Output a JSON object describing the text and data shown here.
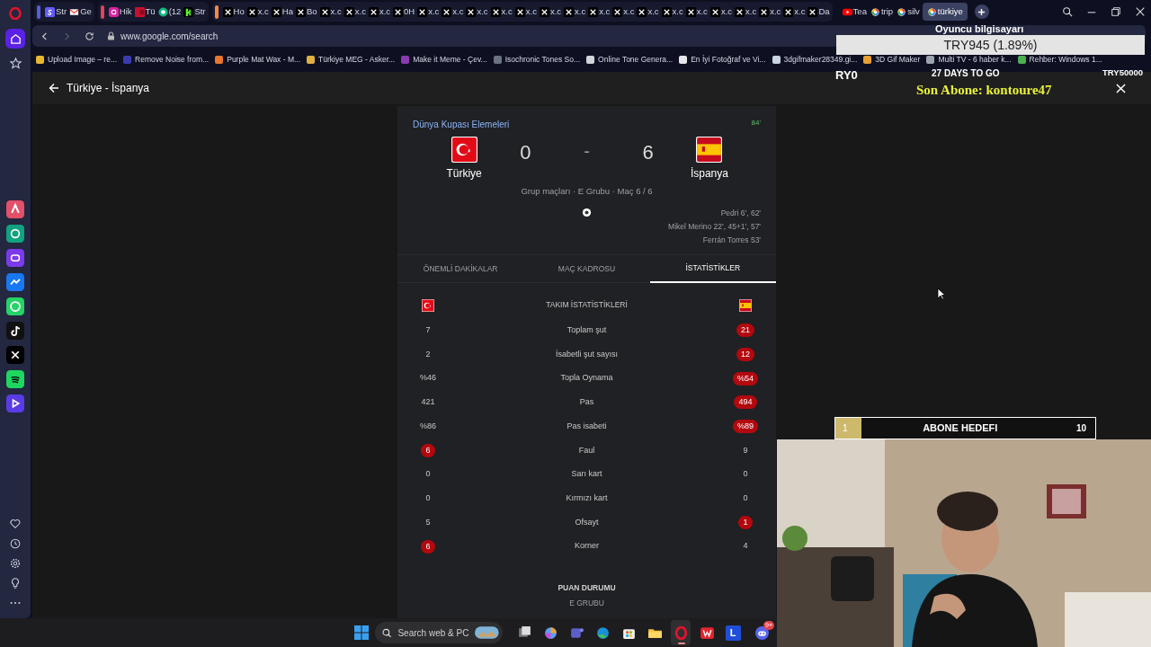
{
  "browser": {
    "tab_groups": [
      {
        "color": "#5b5bd6",
        "tabs": [
          {
            "label": "Str",
            "kind": "stripe",
            "selected": false
          },
          {
            "label": "Ge",
            "kind": "gmail",
            "selected": false
          }
        ]
      },
      {
        "color": "#e0435a",
        "tabs": [
          {
            "label": "Hik",
            "kind": "instagram",
            "selected": false
          },
          {
            "label": "Tü",
            "kind": "flag",
            "selected": false
          },
          {
            "label": "(12",
            "kind": "chat",
            "selected": false
          },
          {
            "label": "Str",
            "kind": "kick",
            "selected": false
          }
        ]
      },
      {
        "color": "#f08a4b",
        "tabs": [
          {
            "label": "Ho",
            "kind": "x",
            "selected": false
          },
          {
            "label": "x.c",
            "kind": "x",
            "selected": false
          },
          {
            "label": "Ha",
            "kind": "x",
            "selected": false
          },
          {
            "label": "Bo",
            "kind": "x",
            "selected": false
          },
          {
            "label": "x.c",
            "kind": "x",
            "selected": false
          },
          {
            "label": "x.c",
            "kind": "x",
            "selected": false
          },
          {
            "label": "x.c",
            "kind": "x",
            "selected": false
          },
          {
            "label": "0H",
            "kind": "x",
            "selected": false
          },
          {
            "label": "x.c",
            "kind": "x",
            "selected": false
          },
          {
            "label": "x.c",
            "kind": "x",
            "selected": false
          },
          {
            "label": "x.c",
            "kind": "x",
            "selected": false
          },
          {
            "label": "x.c",
            "kind": "x",
            "selected": false
          },
          {
            "label": "x.c",
            "kind": "x",
            "selected": false
          },
          {
            "label": "x.c",
            "kind": "x",
            "selected": false
          },
          {
            "label": "x.c",
            "kind": "x",
            "selected": false
          },
          {
            "label": "x.c",
            "kind": "x",
            "selected": false
          },
          {
            "label": "x.c",
            "kind": "x",
            "selected": false
          },
          {
            "label": "x.c",
            "kind": "x",
            "selected": false
          },
          {
            "label": "x.c",
            "kind": "x",
            "selected": false
          },
          {
            "label": "x.c",
            "kind": "x",
            "selected": false
          },
          {
            "label": "x.c",
            "kind": "x",
            "selected": false
          },
          {
            "label": "x.c",
            "kind": "x",
            "selected": false
          },
          {
            "label": "x.c",
            "kind": "x",
            "selected": false
          },
          {
            "label": "x.c",
            "kind": "x",
            "selected": false
          },
          {
            "label": "Da",
            "kind": "x",
            "selected": false
          }
        ]
      }
    ],
    "tabs": [
      {
        "label": "Tea",
        "kind": "youtube",
        "selected": false
      },
      {
        "label": "trip",
        "kind": "google",
        "selected": false
      },
      {
        "label": "silv",
        "kind": "google",
        "selected": false
      },
      {
        "label": "türkiye",
        "kind": "google",
        "selected": true
      }
    ],
    "address": "www.google.com/search",
    "bookmarks": [
      {
        "label": "Upload Image – re...",
        "color": "#e8b730"
      },
      {
        "label": "Remove Noise from...",
        "color": "#3b3bb0"
      },
      {
        "label": "Purple Mat Wax - M...",
        "color": "#e8762c"
      },
      {
        "label": "Türkiye MEG - Asker...",
        "color": "#e0b040"
      },
      {
        "label": "Make it Meme - Çev...",
        "color": "#8b3bb0"
      },
      {
        "label": "Isochronic Tones So...",
        "color": "#6b7280"
      },
      {
        "label": "Online Tone Genera...",
        "color": "#d1d5db"
      },
      {
        "label": "En İyi Fotoğraf ve Vi...",
        "color": "#e5e7eb"
      },
      {
        "label": "3dgifmaker28349.gi...",
        "color": "#cbd5e1"
      },
      {
        "label": "3D Gif Maker",
        "color": "#e8a030"
      },
      {
        "label": "Multi TV - 6 haber k...",
        "color": "#9ca3af"
      },
      {
        "label": "Rehber: Windows 1...",
        "color": "#4caf50"
      }
    ]
  },
  "sidebar_top": [
    {
      "kind": "home",
      "selected": true
    },
    {
      "kind": "star",
      "selected": false
    }
  ],
  "page": {
    "title": "Türkiye - İspanya"
  },
  "match": {
    "competition": "Dünya Kupası Elemeleri",
    "minute": "84'",
    "home": {
      "name": "Türkiye",
      "score": "0"
    },
    "away": {
      "name": "İspanya",
      "score": "6"
    },
    "separator": "-",
    "meta": "Grup maçları · E Grubu · Maç 6 / 6",
    "scorers": [
      "Pedri 6', 62'",
      "Mikel Merino 22', 45+1', 57'",
      "Ferrán Torres 53'"
    ],
    "tabs": [
      {
        "label": "ÖNEMLİ DAKİKALAR",
        "selected": false
      },
      {
        "label": "MAÇ KADROSU",
        "selected": false
      },
      {
        "label": "İSTATİSTİKLER",
        "selected": true
      }
    ],
    "stats_title": "TAKIM İSTATİSTİKLERİ",
    "stats": [
      {
        "home": "7",
        "label": "Toplam şut",
        "away": "21",
        "home_highlighted": false,
        "away_highlighted": true
      },
      {
        "home": "2",
        "label": "İsabetli şut sayısı",
        "away": "12",
        "home_highlighted": false,
        "away_highlighted": true
      },
      {
        "home": "%46",
        "label": "Topla Oynama",
        "away": "%54",
        "home_highlighted": false,
        "away_highlighted": true
      },
      {
        "home": "421",
        "label": "Pas",
        "away": "494",
        "home_highlighted": false,
        "away_highlighted": true
      },
      {
        "home": "%86",
        "label": "Pas isabeti",
        "away": "%89",
        "home_highlighted": false,
        "away_highlighted": true
      },
      {
        "home": "6",
        "label": "Faul",
        "away": "9",
        "home_highlighted": true,
        "away_highlighted": false
      },
      {
        "home": "0",
        "label": "Sarı kart",
        "away": "0",
        "home_highlighted": false,
        "away_highlighted": false
      },
      {
        "home": "0",
        "label": "Kırmızı kart",
        "away": "0",
        "home_highlighted": false,
        "away_highlighted": false
      },
      {
        "home": "5",
        "label": "Ofsayt",
        "away": "1",
        "home_highlighted": false,
        "away_highlighted": true
      },
      {
        "home": "6",
        "label": "Korner",
        "away": "4",
        "home_highlighted": true,
        "away_highlighted": false
      }
    ],
    "standings_title": "PUAN DURUMU",
    "standings_group": "E GRUBU"
  },
  "stream_overlay": {
    "pc_label": "Oyuncu bilgisayarı",
    "price": "TRY945 (1.89%)",
    "ticker": [
      "RY0",
      "27 DAYS TO GO",
      "TRY50000"
    ],
    "last_subscriber": "Son Abone: kontoure47",
    "goal": {
      "label": "ABONE HEDEFI",
      "current": "1",
      "target": "10",
      "level": 0.1
    },
    "webcam": {
      "kind": "picture"
    }
  },
  "taskbar": {
    "search_placeholder": "Search web & PC",
    "apps": [
      {
        "kind": "taskview",
        "active": false
      },
      {
        "kind": "copilot",
        "active": false
      },
      {
        "kind": "teams",
        "active": false
      },
      {
        "kind": "edge",
        "active": false
      },
      {
        "kind": "store",
        "active": false
      },
      {
        "kind": "files",
        "active": false
      },
      {
        "kind": "opera",
        "active": true
      },
      {
        "kind": "wps",
        "active": false
      },
      {
        "kind": "letter",
        "label": "L",
        "active": false
      },
      {
        "kind": "discord",
        "badge": "9+",
        "active": false
      }
    ]
  }
}
